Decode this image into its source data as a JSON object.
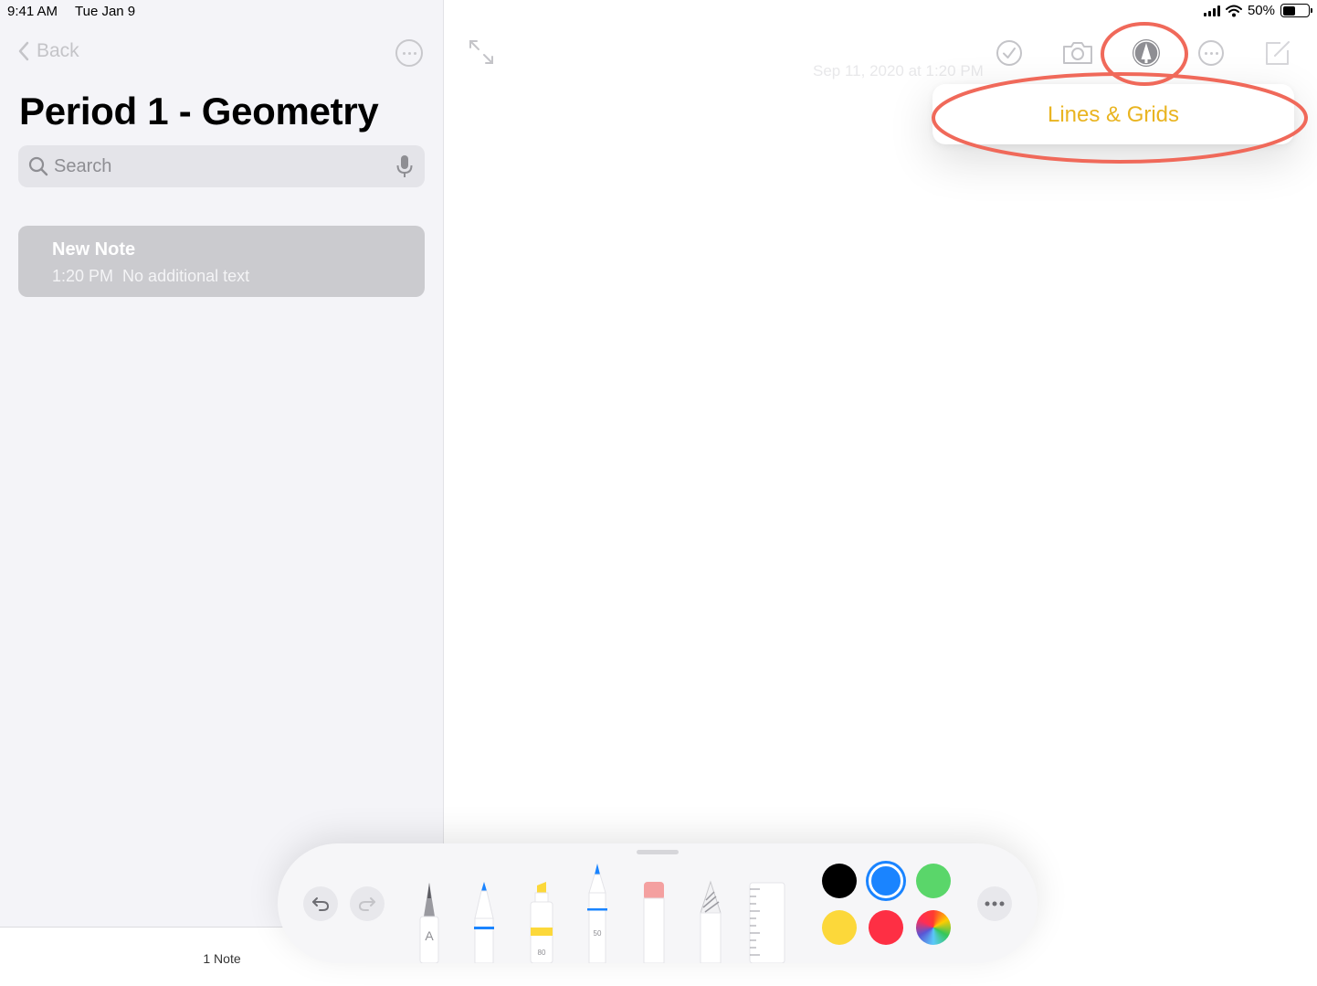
{
  "status_bar": {
    "time": "9:41 AM",
    "date": "Tue Jan 9",
    "battery": "50%",
    "battery_level": 0.5
  },
  "sidebar": {
    "back_label": "Back",
    "folder_title": "Period 1 - Geometry",
    "search": {
      "placeholder": "Search"
    },
    "notes": [
      {
        "title": "New Note",
        "time": "1:20 PM",
        "preview": "No additional text"
      }
    ],
    "footer_count": "1 Note"
  },
  "editor": {
    "date_text": "Sep 11, 2020 at 1:20 PM",
    "toolbar_icons": [
      "checklist-icon",
      "camera-icon",
      "markup-icon",
      "more-icon",
      "compose-icon"
    ],
    "popover": {
      "item_label": "Lines & Grids"
    }
  },
  "drawing_toolbar": {
    "tools": [
      "pen",
      "marker",
      "highlighter",
      "pencil",
      "eraser",
      "lasso",
      "ruler"
    ],
    "pen_label": "A",
    "highlighter_opacity": "80",
    "pencil_size": "50",
    "colors": [
      "#000000",
      "#1a84ff",
      "#5ad66a",
      "#fcd83a",
      "#fe2f44"
    ],
    "selected_color": "#1a84ff"
  },
  "colors": {
    "accent": "#e9b420",
    "annotation": "#f0695a"
  }
}
